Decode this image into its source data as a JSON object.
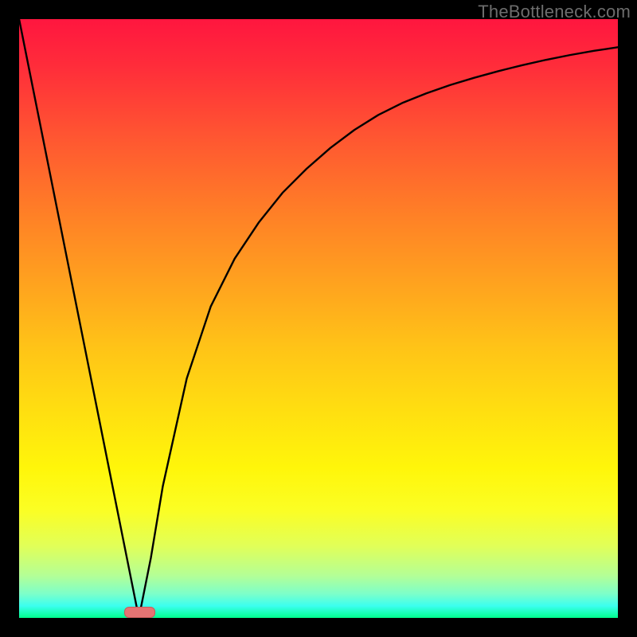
{
  "watermark": "TheBottleneck.com",
  "chart_data": {
    "type": "line",
    "title": "",
    "xlabel": "",
    "ylabel": "",
    "xlim": [
      0,
      100
    ],
    "ylim": [
      0,
      100
    ],
    "grid": false,
    "background_gradient": {
      "top": "#ff163f",
      "middle": "#ffe010",
      "bottom": "#00ff8e"
    },
    "curve_color": "#000000",
    "marker": {
      "x_min": 17.5,
      "x_max": 22.5,
      "y": 0,
      "color": "#e57373"
    },
    "x": [
      0,
      4,
      8,
      12,
      16,
      18,
      20,
      22,
      24,
      28,
      32,
      36,
      40,
      44,
      48,
      52,
      56,
      60,
      64,
      68,
      72,
      76,
      80,
      84,
      88,
      92,
      96,
      100
    ],
    "values": [
      100,
      80,
      60,
      40,
      20,
      10,
      0,
      10,
      22,
      40,
      52,
      60,
      66,
      71,
      75,
      78.5,
      81.5,
      84,
      86,
      87.6,
      89,
      90.2,
      91.3,
      92.3,
      93.2,
      94,
      94.7,
      95.3
    ]
  }
}
